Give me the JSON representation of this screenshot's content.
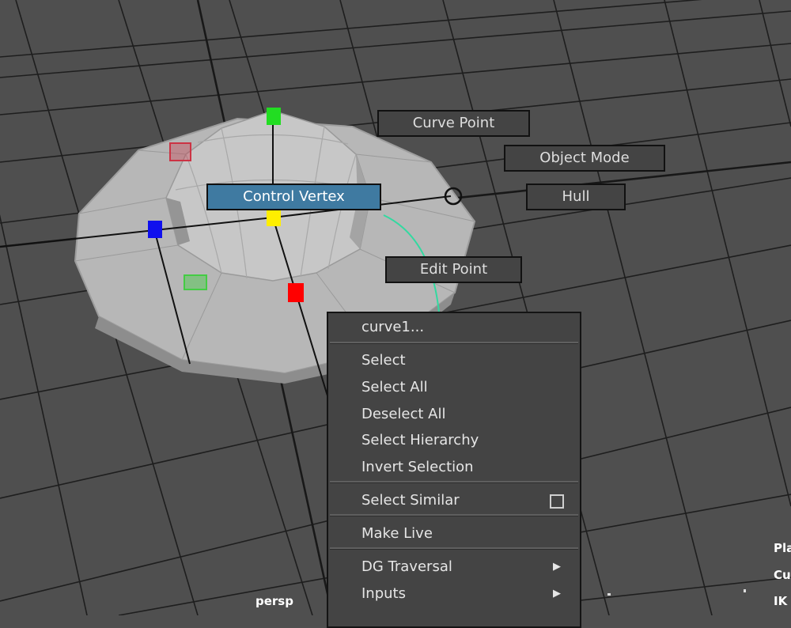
{
  "viewport": {
    "camera_label": "persp",
    "background_color": "#4f4f4f",
    "grid_color": "#1e1e1e"
  },
  "marking_menu": {
    "curve_point": "Curve Point",
    "object_mode": "Object Mode",
    "control_vertex": "Control Vertex",
    "hull": "Hull",
    "edit_point": "Edit Point",
    "highlight_color": "#3f7aa1"
  },
  "context_menu": {
    "title": "curve1...",
    "select": "Select",
    "select_all": "Select All",
    "deselect_all": "Deselect All",
    "select_hierarchy": "Select Hierarchy",
    "invert_selection": "Invert Selection",
    "select_similar": "Select Similar",
    "make_live": "Make Live",
    "dg_traversal": "DG Traversal",
    "inputs": "Inputs"
  },
  "hud": {
    "line1": "Pla",
    "line2": "Cu",
    "line3": "IK"
  },
  "control_vertex_colors": [
    "#22dd22",
    "#ff0000",
    "#ffee00",
    "#1010ee",
    "#44cc44",
    "#cc3344"
  ],
  "icons": [
    "option-box-icon",
    "submenu-arrow-icon",
    "manipulator-circle-icon"
  ]
}
